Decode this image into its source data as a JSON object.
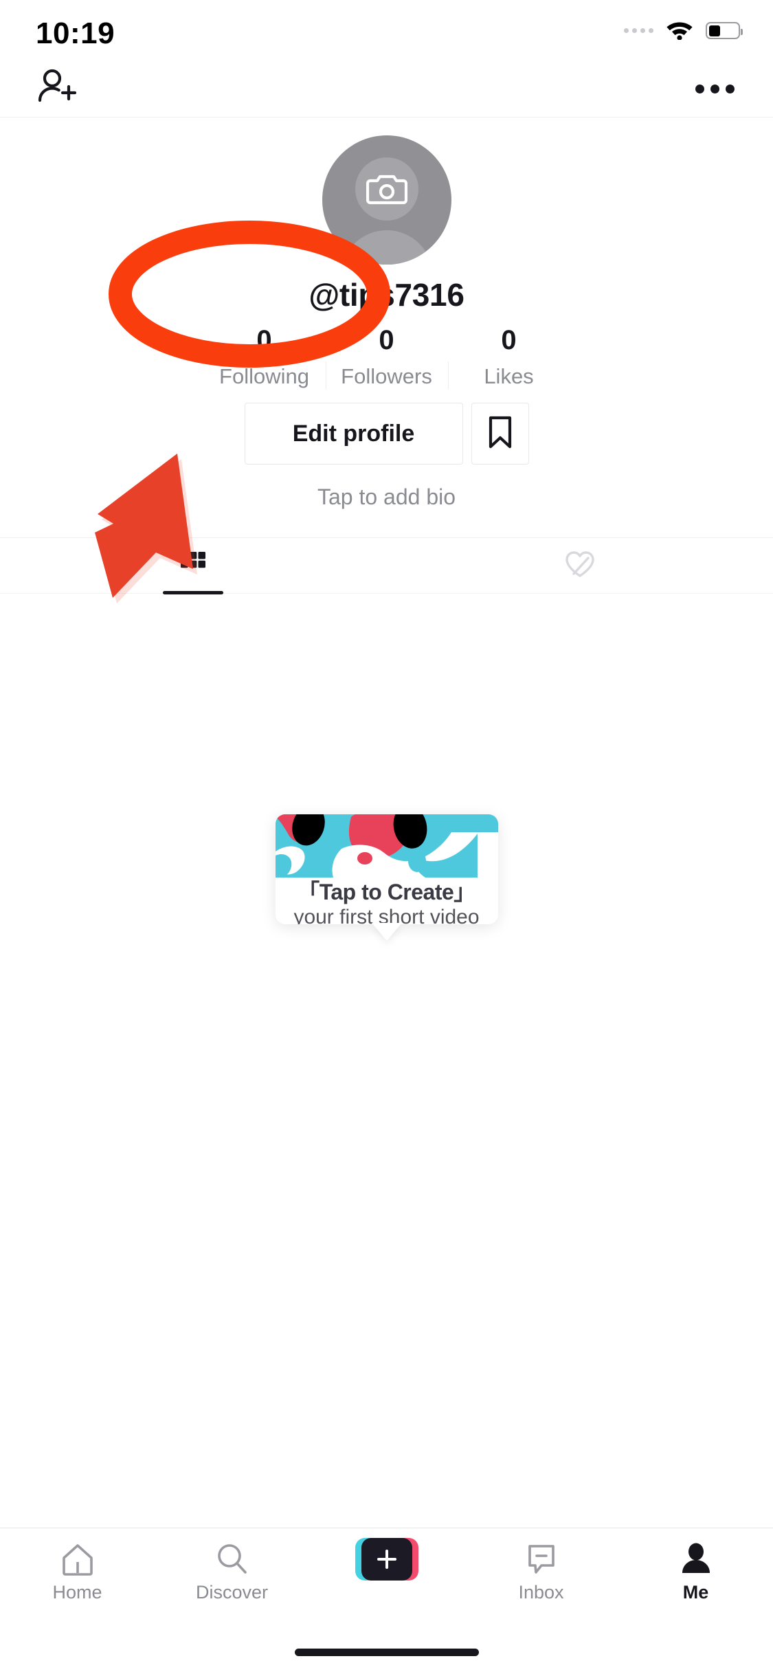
{
  "status_bar": {
    "time": "10:19",
    "cellular_icon": "cellular-dots-icon",
    "wifi_icon": "wifi-icon",
    "battery_icon": "battery-icon",
    "battery_level_percent": 40
  },
  "header": {
    "add_friends_icon": "add-person-icon",
    "more_options_icon": "more-options-icon"
  },
  "profile": {
    "avatar_placeholder_icon": "camera-icon",
    "username": "@tips7316",
    "bio_placeholder": "Tap to add bio",
    "stats": [
      {
        "value": "0",
        "label": "Following"
      },
      {
        "value": "0",
        "label": "Followers"
      },
      {
        "value": "0",
        "label": "Likes"
      }
    ],
    "edit_profile_label": "Edit profile",
    "bookmark_icon": "bookmark-icon"
  },
  "tabs": [
    {
      "icon": "grid-icon",
      "name": "videos",
      "active": true
    },
    {
      "icon": "heart-slash-icon",
      "name": "private-likes",
      "active": false
    }
  ],
  "create_tooltip": {
    "title": "「Tap to Create」",
    "subtitle": "your first short video",
    "art_colors": {
      "cyan": "#4ec8dd",
      "pink": "#e8425b",
      "black": "#000000"
    }
  },
  "bottom_nav": [
    {
      "label": "Home",
      "icon": "home-icon",
      "active": false
    },
    {
      "label": "Discover",
      "icon": "search-icon",
      "active": false
    },
    {
      "label": "",
      "icon": "create-plus-icon",
      "active": false
    },
    {
      "label": "Inbox",
      "icon": "message-icon",
      "active": false
    },
    {
      "label": "Me",
      "icon": "person-icon",
      "active": true
    }
  ],
  "annotations": {
    "highlight_ellipse_color": "#f93d0d",
    "arrow_color": "#e8412a",
    "ellipse_target": "username",
    "arrow_target": "edit-profile-button"
  }
}
